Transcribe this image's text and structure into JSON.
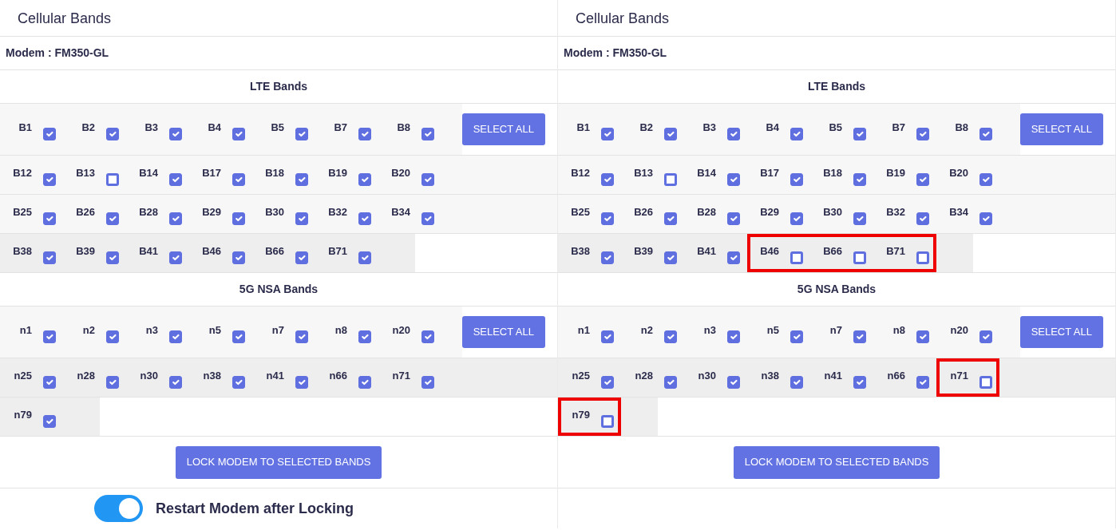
{
  "panels": [
    {
      "title": "Cellular Bands",
      "modem": "Modem : FM350-GL",
      "sections": [
        {
          "heading": "LTE Bands",
          "button": "SELECT ALL",
          "rows": [
            {
              "shaded": false,
              "bands": [
                {
                  "label": "B1",
                  "checked": true,
                  "highlighted": false
                },
                {
                  "label": "B2",
                  "checked": true,
                  "highlighted": false
                },
                {
                  "label": "B3",
                  "checked": true,
                  "highlighted": false
                },
                {
                  "label": "B4",
                  "checked": true,
                  "highlighted": false
                },
                {
                  "label": "B5",
                  "checked": true,
                  "highlighted": false
                },
                {
                  "label": "B7",
                  "checked": true,
                  "highlighted": false
                },
                {
                  "label": "B8",
                  "checked": true,
                  "highlighted": false
                }
              ]
            },
            {
              "shaded": false,
              "bands": [
                {
                  "label": "B12",
                  "checked": true,
                  "highlighted": false
                },
                {
                  "label": "B13",
                  "checked": false,
                  "highlighted": false
                },
                {
                  "label": "B14",
                  "checked": true,
                  "highlighted": false
                },
                {
                  "label": "B17",
                  "checked": true,
                  "highlighted": false
                },
                {
                  "label": "B18",
                  "checked": true,
                  "highlighted": false
                },
                {
                  "label": "B19",
                  "checked": true,
                  "highlighted": false
                },
                {
                  "label": "B20",
                  "checked": true,
                  "highlighted": false
                }
              ]
            },
            {
              "shaded": false,
              "bands": [
                {
                  "label": "B25",
                  "checked": true,
                  "highlighted": false
                },
                {
                  "label": "B26",
                  "checked": true,
                  "highlighted": false
                },
                {
                  "label": "B28",
                  "checked": true,
                  "highlighted": false
                },
                {
                  "label": "B29",
                  "checked": true,
                  "highlighted": false
                },
                {
                  "label": "B30",
                  "checked": true,
                  "highlighted": false
                },
                {
                  "label": "B32",
                  "checked": true,
                  "highlighted": false
                },
                {
                  "label": "B34",
                  "checked": true,
                  "highlighted": false
                }
              ]
            },
            {
              "shaded": true,
              "bands": [
                {
                  "label": "B38",
                  "checked": true,
                  "highlighted": false
                },
                {
                  "label": "B39",
                  "checked": true,
                  "highlighted": false
                },
                {
                  "label": "B41",
                  "checked": true,
                  "highlighted": false
                },
                {
                  "label": "B46",
                  "checked": true,
                  "highlighted": false
                },
                {
                  "label": "B66",
                  "checked": true,
                  "highlighted": false
                },
                {
                  "label": "B71",
                  "checked": true,
                  "highlighted": false
                }
              ]
            }
          ]
        },
        {
          "heading": "5G NSA Bands",
          "button": "SELECT ALL",
          "rows": [
            {
              "shaded": false,
              "bands": [
                {
                  "label": "n1",
                  "checked": true,
                  "highlighted": false
                },
                {
                  "label": "n2",
                  "checked": true,
                  "highlighted": false
                },
                {
                  "label": "n3",
                  "checked": true,
                  "highlighted": false
                },
                {
                  "label": "n5",
                  "checked": true,
                  "highlighted": false
                },
                {
                  "label": "n7",
                  "checked": true,
                  "highlighted": false
                },
                {
                  "label": "n8",
                  "checked": true,
                  "highlighted": false
                },
                {
                  "label": "n20",
                  "checked": true,
                  "highlighted": false
                }
              ]
            },
            {
              "shaded": true,
              "bands": [
                {
                  "label": "n25",
                  "checked": true,
                  "highlighted": false
                },
                {
                  "label": "n28",
                  "checked": true,
                  "highlighted": false
                },
                {
                  "label": "n30",
                  "checked": true,
                  "highlighted": false
                },
                {
                  "label": "n38",
                  "checked": true,
                  "highlighted": false
                },
                {
                  "label": "n41",
                  "checked": true,
                  "highlighted": false
                },
                {
                  "label": "n66",
                  "checked": true,
                  "highlighted": false
                },
                {
                  "label": "n71",
                  "checked": true,
                  "highlighted": false
                }
              ]
            },
            {
              "shaded": true,
              "bands": [
                {
                  "label": "n79",
                  "checked": true,
                  "highlighted": false
                }
              ]
            }
          ]
        }
      ],
      "lock_button": "LOCK MODEM TO SELECTED BANDS",
      "restart_toggle": {
        "label": "Restart Modem after Locking",
        "on": true
      }
    },
    {
      "title": "Cellular Bands",
      "modem": "Modem : FM350-GL",
      "sections": [
        {
          "heading": "LTE Bands",
          "button": "SELECT ALL",
          "rows": [
            {
              "shaded": false,
              "bands": [
                {
                  "label": "B1",
                  "checked": true,
                  "highlighted": false
                },
                {
                  "label": "B2",
                  "checked": true,
                  "highlighted": false
                },
                {
                  "label": "B3",
                  "checked": true,
                  "highlighted": false
                },
                {
                  "label": "B4",
                  "checked": true,
                  "highlighted": false
                },
                {
                  "label": "B5",
                  "checked": true,
                  "highlighted": false
                },
                {
                  "label": "B7",
                  "checked": true,
                  "highlighted": false
                },
                {
                  "label": "B8",
                  "checked": true,
                  "highlighted": false
                }
              ]
            },
            {
              "shaded": false,
              "bands": [
                {
                  "label": "B12",
                  "checked": true,
                  "highlighted": false
                },
                {
                  "label": "B13",
                  "checked": false,
                  "highlighted": false
                },
                {
                  "label": "B14",
                  "checked": true,
                  "highlighted": false
                },
                {
                  "label": "B17",
                  "checked": true,
                  "highlighted": false
                },
                {
                  "label": "B18",
                  "checked": true,
                  "highlighted": false
                },
                {
                  "label": "B19",
                  "checked": true,
                  "highlighted": false
                },
                {
                  "label": "B20",
                  "checked": true,
                  "highlighted": false
                }
              ]
            },
            {
              "shaded": false,
              "bands": [
                {
                  "label": "B25",
                  "checked": true,
                  "highlighted": false
                },
                {
                  "label": "B26",
                  "checked": true,
                  "highlighted": false
                },
                {
                  "label": "B28",
                  "checked": true,
                  "highlighted": false
                },
                {
                  "label": "B29",
                  "checked": true,
                  "highlighted": false
                },
                {
                  "label": "B30",
                  "checked": true,
                  "highlighted": false
                },
                {
                  "label": "B32",
                  "checked": true,
                  "highlighted": false
                },
                {
                  "label": "B34",
                  "checked": true,
                  "highlighted": false
                }
              ]
            },
            {
              "shaded": true,
              "bands": [
                {
                  "label": "B38",
                  "checked": true,
                  "highlighted": false
                },
                {
                  "label": "B39",
                  "checked": true,
                  "highlighted": false
                },
                {
                  "label": "B41",
                  "checked": true,
                  "highlighted": false
                },
                {
                  "label": "B46",
                  "checked": false,
                  "highlighted": true
                },
                {
                  "label": "B66",
                  "checked": false,
                  "highlighted": true
                },
                {
                  "label": "B71",
                  "checked": false,
                  "highlighted": true
                }
              ]
            }
          ]
        },
        {
          "heading": "5G NSA Bands",
          "button": "SELECT ALL",
          "rows": [
            {
              "shaded": false,
              "bands": [
                {
                  "label": "n1",
                  "checked": true,
                  "highlighted": false
                },
                {
                  "label": "n2",
                  "checked": true,
                  "highlighted": false
                },
                {
                  "label": "n3",
                  "checked": true,
                  "highlighted": false
                },
                {
                  "label": "n5",
                  "checked": true,
                  "highlighted": false
                },
                {
                  "label": "n7",
                  "checked": true,
                  "highlighted": false
                },
                {
                  "label": "n8",
                  "checked": true,
                  "highlighted": false
                },
                {
                  "label": "n20",
                  "checked": true,
                  "highlighted": false
                }
              ]
            },
            {
              "shaded": true,
              "bands": [
                {
                  "label": "n25",
                  "checked": true,
                  "highlighted": false
                },
                {
                  "label": "n28",
                  "checked": true,
                  "highlighted": false
                },
                {
                  "label": "n30",
                  "checked": true,
                  "highlighted": false
                },
                {
                  "label": "n38",
                  "checked": true,
                  "highlighted": false
                },
                {
                  "label": "n41",
                  "checked": true,
                  "highlighted": false
                },
                {
                  "label": "n66",
                  "checked": true,
                  "highlighted": false
                },
                {
                  "label": "n71",
                  "checked": false,
                  "highlighted": true
                }
              ]
            },
            {
              "shaded": true,
              "bands": [
                {
                  "label": "n79",
                  "checked": false,
                  "highlighted": true
                }
              ]
            }
          ]
        }
      ],
      "lock_button": "LOCK MODEM TO SELECTED BANDS"
    }
  ]
}
